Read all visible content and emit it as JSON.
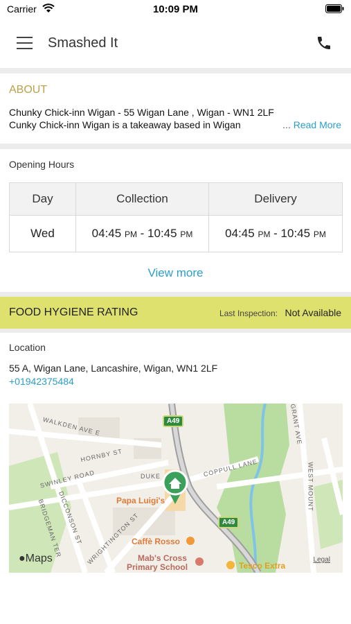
{
  "status_bar": {
    "carrier": "Carrier",
    "time": "10:09 PM"
  },
  "header": {
    "title": "Smashed It",
    "menu_icon": "hamburger-menu-icon",
    "phone_icon": "phone-icon"
  },
  "about": {
    "title": "ABOUT",
    "line1": "Chunky Chick-inn Wigan - 55  Wigan Lane , Wigan  -  WN1 2LF",
    "line2": "Cunky Chick-inn Wigan is a takeaway based in Wigan",
    "read_more_dots": "...",
    "read_more": "Read More"
  },
  "hours": {
    "title": "Opening Hours",
    "headers": [
      "Day",
      "Collection",
      "Delivery"
    ],
    "rows": [
      {
        "day": "Wed",
        "collection_start": "04:45",
        "collection_start_ampm": "PM",
        "collection_end": "10:45",
        "collection_end_ampm": "PM",
        "delivery_start": "04:45",
        "delivery_start_ampm": "PM",
        "delivery_end": "10:45",
        "delivery_end_ampm": "PM"
      }
    ],
    "view_more": "View more"
  },
  "hygiene": {
    "title": "FOOD HYGIENE RATING",
    "inspection_label": "Last Inspection:",
    "inspection_value": "Not Available"
  },
  "location": {
    "title": "Location",
    "address": "55 A, Wigan Lane, Lancashire, Wigan, WN1 2LF",
    "phone": "+01942375484"
  },
  "map": {
    "streets": [
      "WALKDEN AVE E",
      "HORNBY ST",
      "SWINLEY ROAD",
      "DUKE",
      "COPPULL LANE",
      "DICCONSON ST",
      "BRIDGEMAN TER",
      "WRIGHTINGTON ST",
      "WEST MOUNT",
      "GRANT AVE"
    ],
    "pois": [
      "Papa Luigi's",
      "Caffè Rosso",
      "Mab's Cross",
      "Primary School",
      "Tesco Extra"
    ],
    "road": "A49",
    "attribution": "Maps",
    "legal": "Legal"
  }
}
